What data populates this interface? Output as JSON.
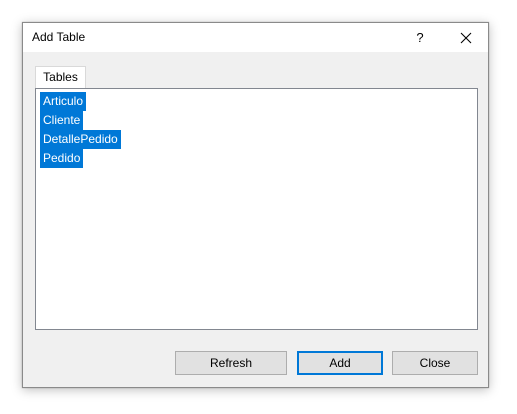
{
  "window": {
    "title": "Add Table",
    "help_label": "?"
  },
  "tabs": [
    {
      "label": "Tables",
      "selected": true
    }
  ],
  "tables": {
    "items": [
      {
        "label": "Articulo",
        "selected": true
      },
      {
        "label": "Cliente",
        "selected": true
      },
      {
        "label": "DetallePedido",
        "selected": true
      },
      {
        "label": "Pedido",
        "selected": true
      }
    ]
  },
  "buttons": {
    "refresh": "Refresh",
    "add": "Add",
    "close": "Close"
  },
  "colors": {
    "selection": "#0078d7",
    "dialog_bg": "#f0f0f0",
    "button_bg": "#e1e1e1"
  },
  "icons": {
    "close": "close-icon"
  }
}
